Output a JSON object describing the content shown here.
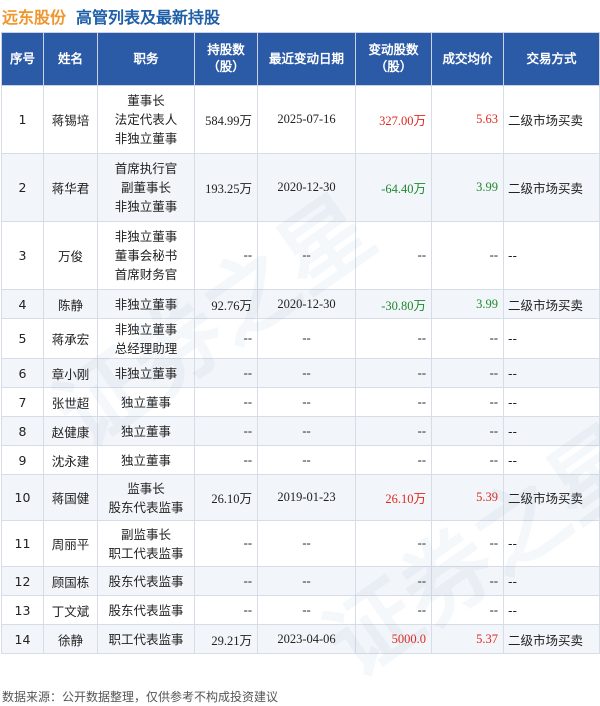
{
  "header": {
    "company": "远东股份",
    "title": "高管列表及最新持股"
  },
  "columns": [
    "序号",
    "姓名",
    "职务",
    "持股数\n（股）",
    "最近变动日期",
    "变动股数\n（股）",
    "成交均价",
    "交易方式"
  ],
  "rows": [
    {
      "idx": "1",
      "name": "蒋锡培",
      "positions": [
        "董事长",
        "法定代表人",
        "非独立董事"
      ],
      "shares": "584.99万",
      "date": "2025-07-16",
      "change": "327.00万",
      "change_color": "red",
      "price": "5.63",
      "price_color": "red",
      "method": "二级市场买卖"
    },
    {
      "idx": "2",
      "name": "蒋华君",
      "positions": [
        "首席执行官",
        "副董事长",
        "非独立董事"
      ],
      "shares": "193.25万",
      "date": "2020-12-30",
      "change": "-64.40万",
      "change_color": "green",
      "price": "3.99",
      "price_color": "green",
      "method": "二级市场买卖"
    },
    {
      "idx": "3",
      "name": "万俊",
      "positions": [
        "非独立董事",
        "董事会秘书",
        "首席财务官"
      ],
      "shares": "--",
      "date": "--",
      "change": "--",
      "change_color": "",
      "price": "--",
      "price_color": "",
      "method": "--"
    },
    {
      "idx": "4",
      "name": "陈静",
      "positions": [
        "非独立董事"
      ],
      "shares": "92.76万",
      "date": "2020-12-30",
      "change": "-30.80万",
      "change_color": "green",
      "price": "3.99",
      "price_color": "green",
      "method": "二级市场买卖"
    },
    {
      "idx": "5",
      "name": "蒋承宏",
      "positions": [
        "非独立董事",
        "总经理助理"
      ],
      "shares": "--",
      "date": "--",
      "change": "--",
      "change_color": "",
      "price": "--",
      "price_color": "",
      "method": "--"
    },
    {
      "idx": "6",
      "name": "章小刚",
      "positions": [
        "非独立董事"
      ],
      "shares": "--",
      "date": "--",
      "change": "--",
      "change_color": "",
      "price": "--",
      "price_color": "",
      "method": "--"
    },
    {
      "idx": "7",
      "name": "张世超",
      "positions": [
        "独立董事"
      ],
      "shares": "--",
      "date": "--",
      "change": "--",
      "change_color": "",
      "price": "--",
      "price_color": "",
      "method": "--"
    },
    {
      "idx": "8",
      "name": "赵健康",
      "positions": [
        "独立董事"
      ],
      "shares": "--",
      "date": "--",
      "change": "--",
      "change_color": "",
      "price": "--",
      "price_color": "",
      "method": "--"
    },
    {
      "idx": "9",
      "name": "沈永建",
      "positions": [
        "独立董事"
      ],
      "shares": "--",
      "date": "--",
      "change": "--",
      "change_color": "",
      "price": "--",
      "price_color": "",
      "method": "--"
    },
    {
      "idx": "10",
      "name": "蒋国健",
      "positions": [
        "监事长",
        "股东代表监事"
      ],
      "shares": "26.10万",
      "date": "2019-01-23",
      "change": "26.10万",
      "change_color": "red",
      "price": "5.39",
      "price_color": "red",
      "method": "二级市场买卖"
    },
    {
      "idx": "11",
      "name": "周丽平",
      "positions": [
        "副监事长",
        "职工代表监事"
      ],
      "shares": "--",
      "date": "--",
      "change": "--",
      "change_color": "",
      "price": "--",
      "price_color": "",
      "method": "--"
    },
    {
      "idx": "12",
      "name": "顾国栋",
      "positions": [
        "股东代表监事"
      ],
      "shares": "--",
      "date": "--",
      "change": "--",
      "change_color": "",
      "price": "--",
      "price_color": "",
      "method": "--"
    },
    {
      "idx": "13",
      "name": "丁文斌",
      "positions": [
        "股东代表监事"
      ],
      "shares": "--",
      "date": "--",
      "change": "--",
      "change_color": "",
      "price": "--",
      "price_color": "",
      "method": "--"
    },
    {
      "idx": "14",
      "name": "徐静",
      "positions": [
        "职工代表监事"
      ],
      "shares": "29.21万",
      "date": "2023-04-06",
      "change": "5000.0",
      "change_color": "red",
      "price": "5.37",
      "price_color": "red",
      "method": "二级市场买卖"
    }
  ],
  "footer": {
    "source": "数据来源：公开数据整理，仅供参考不构成投资建议"
  },
  "watermark": "证券之星"
}
